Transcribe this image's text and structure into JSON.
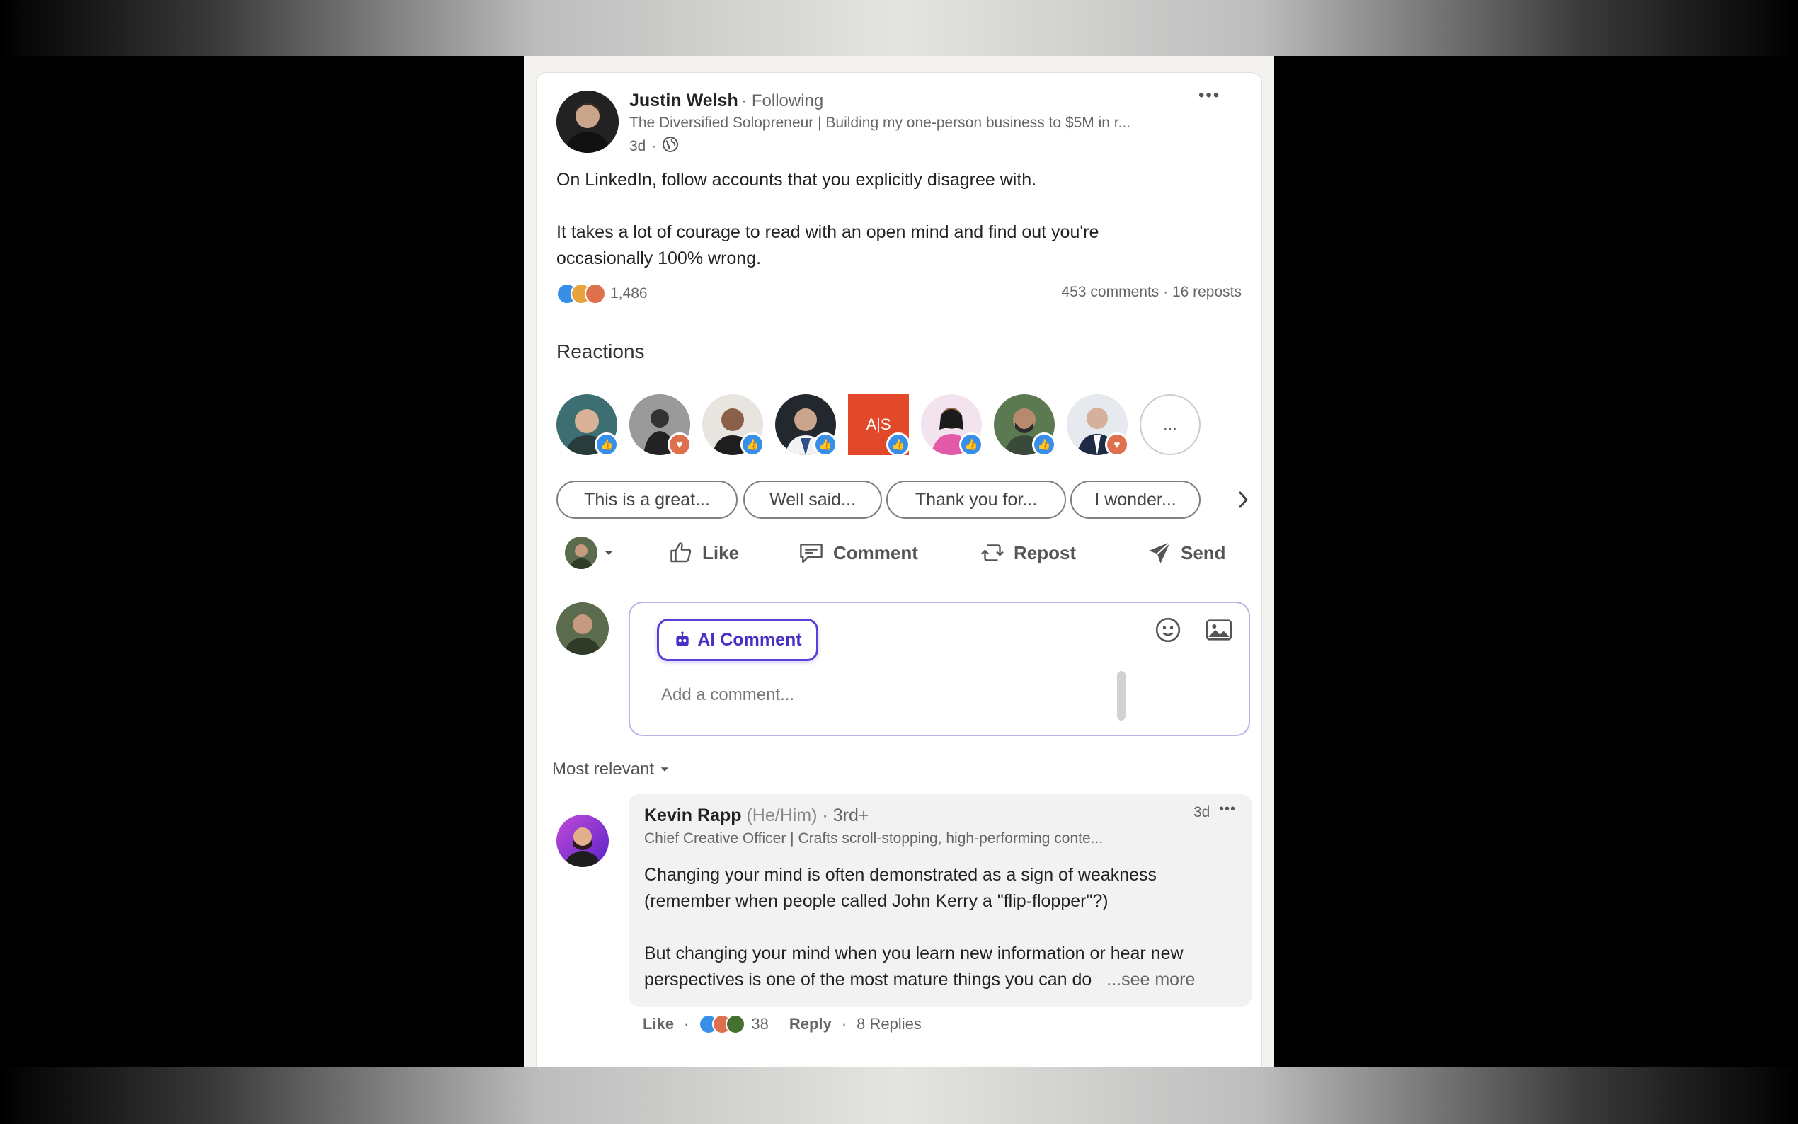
{
  "post": {
    "author": "Justin Welsh",
    "following": "Following",
    "headline": "The Diversified Solopreneur | Building my one-person business to $5M in r...",
    "time": "3d",
    "text_line1": "On LinkedIn, follow accounts that you explicitly disagree with.",
    "text_line2": "It takes a lot of courage to read with an open mind and find out you're",
    "text_line3": "occasionally 100% wrong.",
    "reaction_count": "1,486",
    "comments_reposts": "453 comments · 16 reposts",
    "more_glyph": "•••"
  },
  "reactions": {
    "title": "Reactions",
    "more": "...",
    "avatar_colors": [
      "#3d6f72",
      "#8e8e8e",
      "#7a5a48",
      "#23272e",
      "#e2482a",
      "#e38ac4",
      "#5b7a52",
      "#4a5a78"
    ],
    "avatar_badges": [
      "like",
      "love",
      "like",
      "like",
      "like",
      "like",
      "like",
      "love"
    ],
    "tile_text": "A|S"
  },
  "suggestions": [
    "This is a great...",
    "Well said...",
    "Thank you for...",
    "I wonder..."
  ],
  "actions": {
    "like": "Like",
    "comment": "Comment",
    "repost": "Repost",
    "send": "Send"
  },
  "composer": {
    "ai_button": "AI Comment",
    "placeholder": "Add a comment..."
  },
  "sort": {
    "label": "Most relevant"
  },
  "comment": {
    "author": "Kevin Rapp",
    "pronouns": "(He/Him)",
    "degree": "· 3rd+",
    "headline": "Chief Creative Officer | Crafts scroll-stopping, high-performing conte...",
    "time": "3d",
    "line1": "Changing your mind is often demonstrated as a sign of weakness",
    "line2": "(remember when people called John Kerry a \"flip-flopper\"?)",
    "line3": "But changing your mind when you learn new information or hear new",
    "line4": "perspectives is one of the most mature things you can do",
    "see_more": "...see more",
    "like": "Like",
    "reaction_count": "38",
    "reply": "Reply",
    "replies": "8 Replies"
  },
  "colors": {
    "accent_purple": "#5b3fd6",
    "like_blue": "#378fe9",
    "love_red": "#df704d"
  }
}
